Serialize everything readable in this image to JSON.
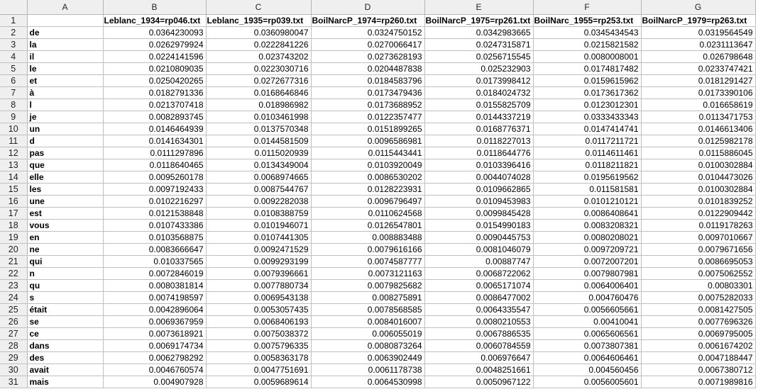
{
  "columns": [
    "A",
    "B",
    "C",
    "D",
    "E",
    "F",
    "G"
  ],
  "headers": [
    "",
    "Leblanc_1934=rp046.txt",
    "Leblanc_1935=rp039.txt",
    "BoilNarcP_1974=rp260.txt",
    "BoilNarcP_1975=rp261.txt",
    "BoilNarc_1955=rp253.txt",
    "BoilNarcP_1979=rp263.txt"
  ],
  "rows": [
    [
      "de",
      "0.0364230093",
      "0.0360980047",
      "0.0324750152",
      "0.0342983665",
      "0.0345434543",
      "0.0319564549"
    ],
    [
      "la",
      "0.0262979924",
      "0.0222841226",
      "0.0270066417",
      "0.0247315871",
      "0.0215821582",
      "0.0231113647"
    ],
    [
      "il",
      "0.0224141596",
      "0.023743202",
      "0.0273628193",
      "0.0256715545",
      "0.0080008001",
      "0.026798648"
    ],
    [
      "le",
      "0.0210809035",
      "0.0223030716",
      "0.0204487838",
      "0.025232903",
      "0.0174817482",
      "0.0233747421"
    ],
    [
      "et",
      "0.0250420265",
      "0.0272677316",
      "0.0184583796",
      "0.0173998412",
      "0.0159615962",
      "0.0181291427"
    ],
    [
      "à",
      "0.0182791336",
      "0.0168646846",
      "0.0173479436",
      "0.0184024732",
      "0.0173617362",
      "0.0173390106"
    ],
    [
      "l",
      "0.0213707418",
      "0.018986982",
      "0.0173688952",
      "0.0155825709",
      "0.0123012301",
      "0.016658619"
    ],
    [
      "je",
      "0.0082893745",
      "0.0103461998",
      "0.0122357477",
      "0.0144337219",
      "0.0333433343",
      "0.0113471753"
    ],
    [
      "un",
      "0.0146464939",
      "0.0137570348",
      "0.0151899265",
      "0.0168776371",
      "0.0147414741",
      "0.0146613406"
    ],
    [
      "d",
      "0.0141634301",
      "0.0144581509",
      "0.0096586981",
      "0.0118227013",
      "0.0117211721",
      "0.0125982178"
    ],
    [
      "pas",
      "0.0111297896",
      "0.0115020939",
      "0.0115443441",
      "0.0118644776",
      "0.0114611461",
      "0.0115886045"
    ],
    [
      "que",
      "0.0118640465",
      "0.0134349004",
      "0.0103920049",
      "0.0103396416",
      "0.0118211821",
      "0.0100302884"
    ],
    [
      "elle",
      "0.0095260178",
      "0.0068974665",
      "0.0086530202",
      "0.0044074028",
      "0.0195619562",
      "0.0104473026"
    ],
    [
      "les",
      "0.0097192433",
      "0.0087544767",
      "0.0128223931",
      "0.0109662865",
      "0.011581581",
      "0.0100302884"
    ],
    [
      "une",
      "0.0102216297",
      "0.0092282038",
      "0.0096796497",
      "0.0109453983",
      "0.0101210121",
      "0.0101839252"
    ],
    [
      "est",
      "0.0121538848",
      "0.0108388759",
      "0.0110624568",
      "0.0099845428",
      "0.0086408641",
      "0.0122909442"
    ],
    [
      "vous",
      "0.0107433386",
      "0.0101946071",
      "0.0126547801",
      "0.0154990183",
      "0.0083208321",
      "0.0119178263"
    ],
    [
      "en",
      "0.0103568875",
      "0.0107441305",
      "0.008883488",
      "0.0090445753",
      "0.0080208021",
      "0.0097010667"
    ],
    [
      "ne",
      "0.0083666647",
      "0.0092471529",
      "0.0079616166",
      "0.0081046079",
      "0.0097209721",
      "0.0079671656"
    ],
    [
      "qui",
      "0.010337565",
      "0.0099293199",
      "0.0074587777",
      "0.00887747",
      "0.0072007201",
      "0.0086695053"
    ],
    [
      "n",
      "0.0072846019",
      "0.0079396661",
      "0.0073121163",
      "0.0068722062",
      "0.0079807981",
      "0.0075062552"
    ],
    [
      "qu",
      "0.0080381814",
      "0.0077880734",
      "0.0079825682",
      "0.0065171074",
      "0.0064006401",
      "0.00803301"
    ],
    [
      "s",
      "0.0074198597",
      "0.0069543138",
      "0.008275891",
      "0.0086477002",
      "0.004760476",
      "0.0075282033"
    ],
    [
      "était",
      "0.0042896064",
      "0.0053057435",
      "0.0078568585",
      "0.0064335547",
      "0.0056605661",
      "0.0081427505"
    ],
    [
      "se",
      "0.0069367959",
      "0.0068406193",
      "0.0084016007",
      "0.0080210553",
      "0.00410041",
      "0.0077696326"
    ],
    [
      "ce",
      "0.0073618921",
      "0.0075038372",
      "0.006055019",
      "0.0067886535",
      "0.0065606561",
      "0.0069795005"
    ],
    [
      "dans",
      "0.0069174734",
      "0.0075796335",
      "0.0080873264",
      "0.0060784559",
      "0.0073807381",
      "0.0061674202"
    ],
    [
      "des",
      "0.0062798292",
      "0.0058363178",
      "0.0063902449",
      "0.006976647",
      "0.0064606461",
      "0.0047188447"
    ],
    [
      "avait",
      "0.0046760574",
      "0.0047751691",
      "0.0061178738",
      "0.0048251661",
      "0.004560456",
      "0.0067380712"
    ],
    [
      "mais",
      "0.004907928",
      "0.0059689614",
      "0.0064530998",
      "0.0050967122",
      "0.0056005601",
      "0.0071989816"
    ]
  ]
}
